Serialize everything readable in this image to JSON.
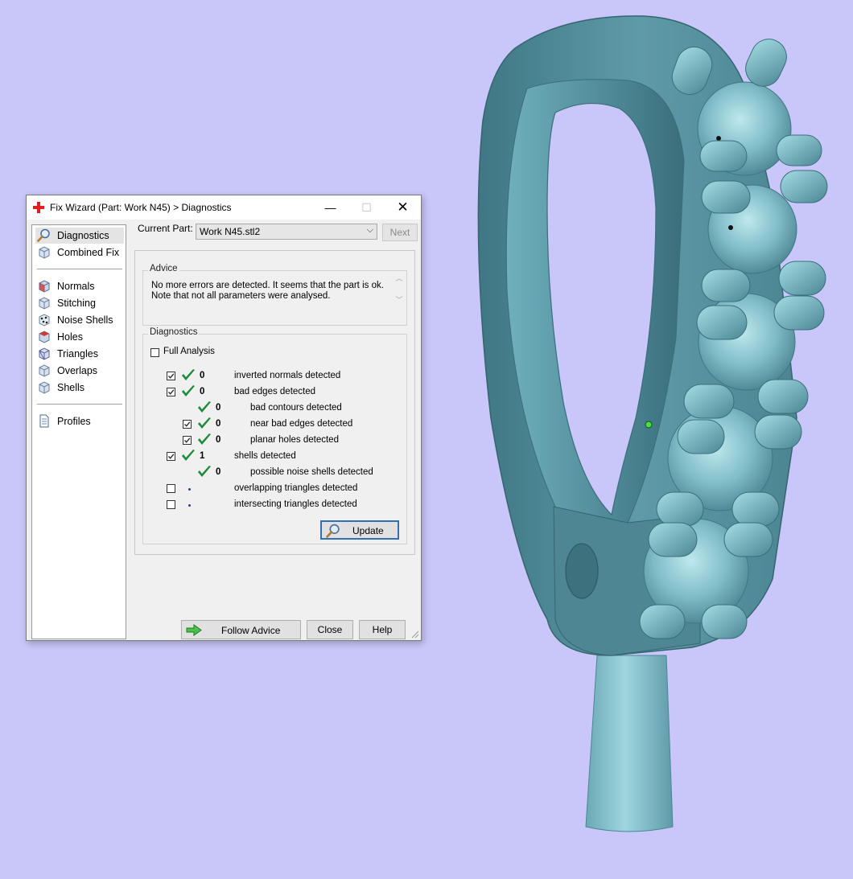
{
  "dialog": {
    "title": "Fix Wizard (Part: Work N45) > Diagnostics",
    "min_glyph": "—",
    "max_glyph": "☐",
    "close_glyph": "✕"
  },
  "sidebar": {
    "top_items": [
      {
        "label": "Diagnostics",
        "icon": "magnifier-icon",
        "active": true
      },
      {
        "label": "Combined Fix",
        "icon": "cube-icon"
      }
    ],
    "fix_items": [
      {
        "label": "Normals",
        "icon": "cube-normals-icon"
      },
      {
        "label": "Stitching",
        "icon": "cube-stitching-icon"
      },
      {
        "label": "Noise Shells",
        "icon": "noise-shells-icon"
      },
      {
        "label": "Holes",
        "icon": "cube-holes-icon"
      },
      {
        "label": "Triangles",
        "icon": "triangles-icon"
      },
      {
        "label": "Overlaps",
        "icon": "overlaps-icon"
      },
      {
        "label": "Shells",
        "icon": "shells-icon"
      }
    ],
    "bottom_items": [
      {
        "label": "Profiles",
        "icon": "document-icon"
      }
    ]
  },
  "current_part": {
    "label": "Current Part:",
    "value": "Work N45.stl2",
    "next_label": "Next"
  },
  "advice": {
    "title": "Advice",
    "lines": [
      "No more errors are detected. It seems that the part is ok.",
      "Note that not all parameters were analysed."
    ]
  },
  "diagnostics": {
    "title": "Diagnostics",
    "full_analysis_label": "Full Analysis",
    "full_analysis_checked": false,
    "rows": [
      {
        "checkbox": true,
        "checked": true,
        "status": "ok",
        "count": "0",
        "label": "inverted normals detected",
        "indent": 0
      },
      {
        "checkbox": true,
        "checked": true,
        "status": "ok",
        "count": "0",
        "label": "bad edges detected",
        "indent": 0
      },
      {
        "checkbox": false,
        "checked": false,
        "status": "ok",
        "count": "0",
        "label": "bad contours detected",
        "indent": 1
      },
      {
        "checkbox": true,
        "checked": true,
        "status": "ok",
        "count": "0",
        "label": "near bad edges detected",
        "indent": 1
      },
      {
        "checkbox": true,
        "checked": true,
        "status": "ok",
        "count": "0",
        "label": "planar holes detected",
        "indent": 1
      },
      {
        "checkbox": true,
        "checked": true,
        "status": "ok",
        "count": "1",
        "label": "shells detected",
        "indent": 0
      },
      {
        "checkbox": false,
        "checked": false,
        "status": "ok",
        "count": "0",
        "label": "possible noise shells detected",
        "indent": 1
      },
      {
        "checkbox": true,
        "checked": false,
        "status": "none",
        "count": "",
        "label": "overlapping triangles detected",
        "indent": 0
      },
      {
        "checkbox": true,
        "checked": false,
        "status": "none",
        "count": "",
        "label": "intersecting triangles detected",
        "indent": 0
      }
    ],
    "update_label": "Update"
  },
  "footer": {
    "follow_advice_label": "Follow Advice",
    "close_label": "Close",
    "help_label": "Help"
  },
  "colors": {
    "background": "#c9c6f9",
    "model_body": "#5f9aa8",
    "model_light": "#9ad4dc",
    "ok_check": "#1e8a3c",
    "title_icon": "#e02020"
  }
}
